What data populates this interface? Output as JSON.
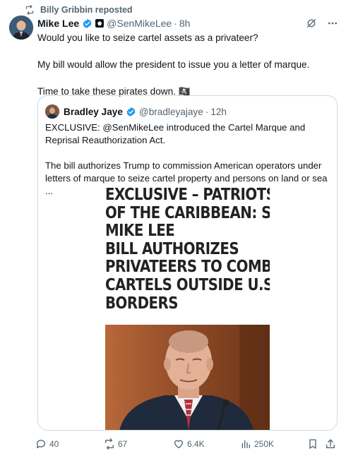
{
  "repost": {
    "icon": "repost-icon",
    "label": "Billy Gribbin reposted"
  },
  "tweet": {
    "author_name": "Mike Lee",
    "handle": "@SenMikeLee",
    "separator": "·",
    "time": "8h",
    "paragraphs": [
      "Would you like to seize cartel assets as a privateer?",
      "My bill would allow the president to issue you a letter of marque.",
      "Time to take these pirates down. 🏴‍☠️"
    ]
  },
  "quote": {
    "author_name": "Bradley Jaye",
    "handle": "@bradleyajaye",
    "separator": "·",
    "time": "12h",
    "paragraphs": [
      "EXCLUSIVE: @SenMikeLee introduced the Cartel Marque and Reprisal Reauthorization Act.",
      "The bill authorizes Trump to commission American operators under letters of marque to seize cartel property and persons on land or sea ..."
    ],
    "image_headline": [
      "EXCLUSIVE – PATRIOTS",
      "OF THE CARIBBEAN: SEN.",
      "MIKE LEE",
      "BILL AUTHORIZES",
      "PRIVATEERS TO COMBAT",
      "CARTELS OUTSIDE U.S.",
      "BORDERS"
    ]
  },
  "actions": {
    "replies": "40",
    "reposts": "67",
    "likes": "6.4K",
    "views": "250K"
  },
  "colors": {
    "text": "#0f1419",
    "secondary": "#536471",
    "verified": "#1d9bf0",
    "border": "#cfd9de"
  }
}
